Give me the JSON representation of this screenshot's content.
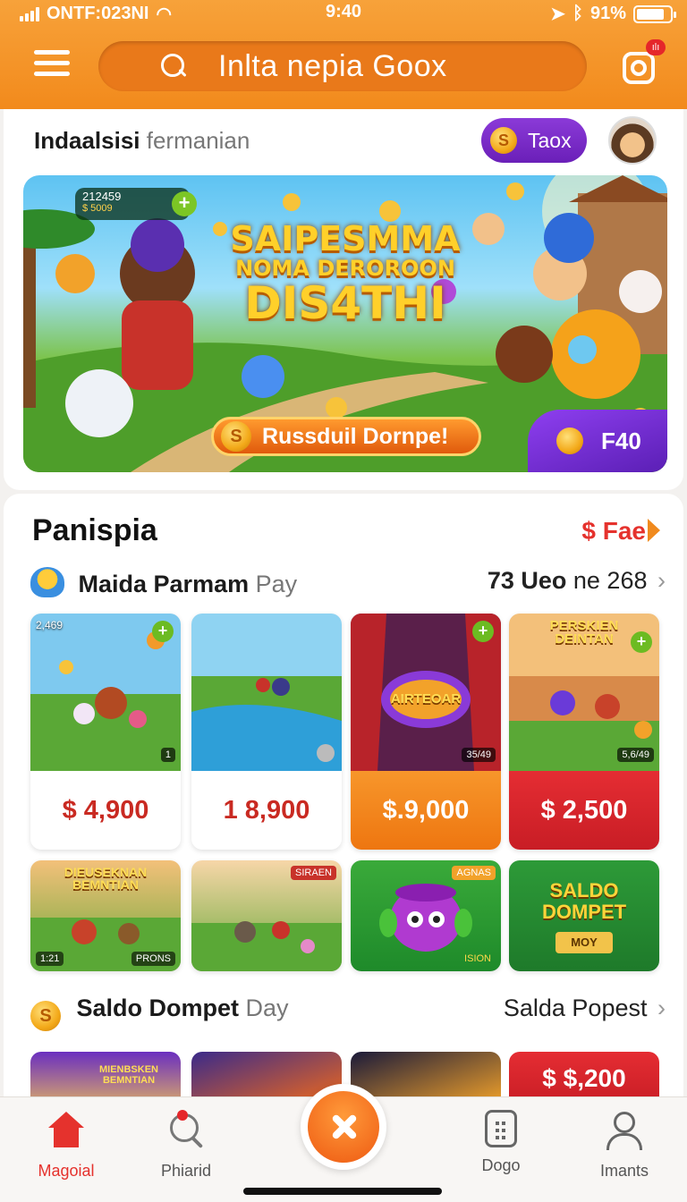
{
  "status_bar": {
    "carrier": "ONTF:023NI",
    "time": "9:40",
    "battery": "91%"
  },
  "header": {
    "search_placeholder": "Inlta nepia Goox",
    "camera_badge": "ılı"
  },
  "top_section": {
    "greeting_bold": "Indaalsisi",
    "greeting_light": "fermanian",
    "coin_button": "Taox",
    "coin_symbol": "S"
  },
  "banner": {
    "score_main": "212459",
    "score_sub": "$ 5009",
    "headline_line1": "SAIPESMMA",
    "headline_line2": "NOMA DEROROON",
    "headline_line3": "DIS4THI",
    "cta_label": "Russduil Dornpe!",
    "corner_value": "F40"
  },
  "section": {
    "title": "Panispia",
    "see_all": "$ Fae",
    "row1": {
      "title_bold": "Maida Parmam",
      "title_light": "Pay",
      "link_bold": "73 Ueo",
      "link_light": "ne 268",
      "chevron": "›"
    },
    "row2": {
      "title_bold": "Saldo Dompet",
      "title_light": "Day",
      "link_light": "Salda Popest",
      "chevron": "›"
    }
  },
  "products": [
    {
      "price": "$ 4,900",
      "overlay": "2,469",
      "tag": "1"
    },
    {
      "price": "1 8,900"
    },
    {
      "price": "$.9,000",
      "sign": "AIRTEOAR",
      "tag": "35/49"
    },
    {
      "price": "$ 2,500",
      "sign": "PERSKIEN DEINTAN",
      "tag": "5,6/49"
    }
  ],
  "small_tiles": [
    {
      "sign": "DIEUSEKNAN BEMNTIAN",
      "tag_left": "1:21",
      "tag_right": "PRONS"
    },
    {
      "sign": "",
      "tag_right": "SIRAEN"
    },
    {
      "tag_top": "AGNAS",
      "tag_bottom": "ISION"
    },
    {
      "line1": "SALDO",
      "line2": "DOMPET",
      "button": "MOY"
    }
  ],
  "third_row": [
    {
      "sign": "MIENBSKEN BEMNTIAN"
    },
    {},
    {},
    {
      "price": "$ $,200"
    }
  ],
  "bottom_nav": {
    "home": "Magoial",
    "search": "Phiarid",
    "orders": "Dogo",
    "account": "Imants"
  },
  "colors": {
    "brand_orange": "#f28a1c",
    "accent_red": "#e5322d",
    "coin_purple": "#7a2cc8"
  }
}
